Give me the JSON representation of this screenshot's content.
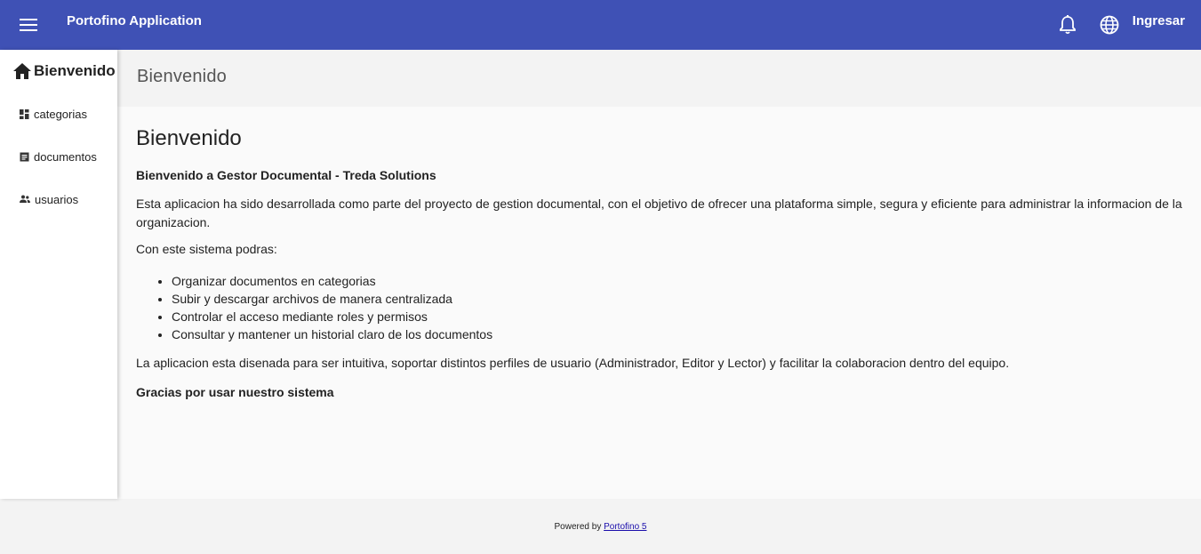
{
  "toolbar": {
    "app_title": "Portofino Application",
    "login_label": "Ingresar",
    "menu_icon": "menu-icon",
    "bell_icon": "bell-icon",
    "globe_icon": "globe-icon",
    "background_color": "#3f51b5"
  },
  "sidebar": {
    "header": {
      "label": "Bienvenido",
      "icon": "home-icon"
    },
    "items": [
      {
        "label": "categorias",
        "icon": "dashboard-icon"
      },
      {
        "label": "documentos",
        "icon": "document-icon"
      },
      {
        "label": "usuarios",
        "icon": "people-icon"
      }
    ]
  },
  "content_header": {
    "title": "Bienvenido"
  },
  "main": {
    "heading": "Bienvenido",
    "subtitle": "Bienvenido a Gestor Documental - Treda Solutions",
    "paragraph1": "Esta aplicacion ha sido desarrollada como parte del proyecto de gestion documental, con el objetivo de ofrecer una plataforma simple, segura y eficiente para administrar la informacion de la organizacion.",
    "paragraph2": "Con este sistema podras:",
    "bullets": [
      "Organizar documentos en categorias",
      "Subir y descargar archivos de manera centralizada",
      "Controlar el acceso mediante roles y permisos",
      "Consultar y mantener un historial claro de los documentos"
    ],
    "paragraph3": "La aplicacion esta disenada para ser intuitiva, soportar distintos perfiles de usuario (Administrador, Editor y Lector) y facilitar la colaboracion dentro del equipo.",
    "thanks": "Gracias por usar nuestro sistema"
  },
  "footer": {
    "prefix": "Powered by",
    "link_label": "Portofino 5"
  }
}
